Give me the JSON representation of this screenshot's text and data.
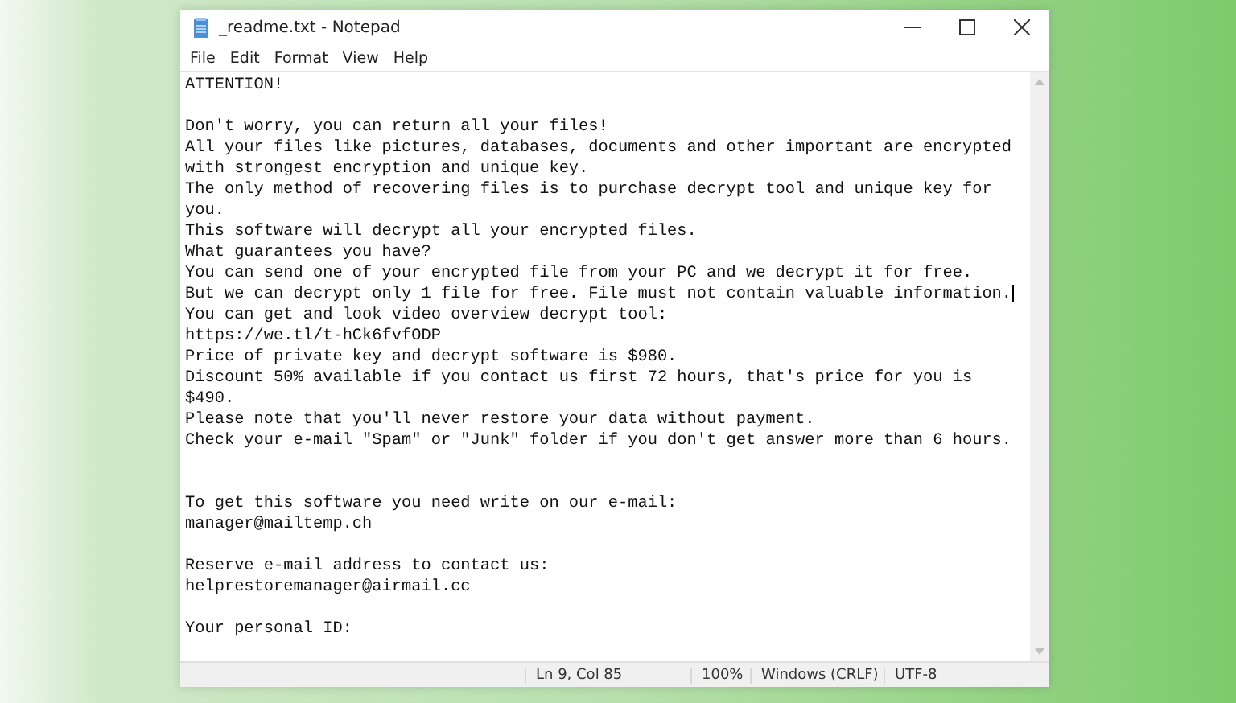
{
  "window": {
    "title": "_readme.txt - Notepad"
  },
  "menu": [
    "File",
    "Edit",
    "Format",
    "View",
    "Help"
  ],
  "lines": [
    {
      "kind": "text",
      "text": "ATTENTION!"
    },
    {
      "kind": "blank"
    },
    {
      "kind": "text",
      "text": "Don't worry, you can return all your files!"
    },
    {
      "kind": "text",
      "text": "All your files like pictures, databases, documents and other important are encrypted"
    },
    {
      "kind": "text",
      "text": "with strongest encryption and unique key."
    },
    {
      "kind": "text",
      "text": "The only method of recovering files is to purchase decrypt tool and unique key for"
    },
    {
      "kind": "text",
      "text": "you."
    },
    {
      "kind": "text",
      "text": "This software will decrypt all your encrypted files."
    },
    {
      "kind": "text",
      "text": "What guarantees you have?"
    },
    {
      "kind": "text",
      "text": "You can send one of your encrypted file from your PC and we decrypt it for free."
    },
    {
      "kind": "text",
      "text": "But we can decrypt only 1 file for free. File must not contain valuable information.",
      "caret": true
    },
    {
      "kind": "text",
      "text": "You can get and look video overview decrypt tool:"
    },
    {
      "kind": "text",
      "text": "https://we.tl/t-hCk6fvfODP"
    },
    {
      "kind": "text",
      "text": "Price of private key and decrypt software is $980."
    },
    {
      "kind": "text",
      "text": "Discount 50% available if you contact us first 72 hours, that's price for you is"
    },
    {
      "kind": "text",
      "text": "$490."
    },
    {
      "kind": "text",
      "text": "Please note that you'll never restore your data without payment."
    },
    {
      "kind": "text",
      "text": "Check your e-mail \"Spam\" or \"Junk\" folder if you don't get answer more than 6 hours."
    },
    {
      "kind": "blank"
    },
    {
      "kind": "blank"
    },
    {
      "kind": "text",
      "text": "To get this software you need write on our e-mail:"
    },
    {
      "kind": "text",
      "text": "manager@mailtemp.ch"
    },
    {
      "kind": "blank"
    },
    {
      "kind": "text",
      "text": "Reserve e-mail address to contact us:"
    },
    {
      "kind": "text",
      "text": "helprestoremanager@airmail.cc"
    },
    {
      "kind": "blank"
    },
    {
      "kind": "text",
      "text": "Your personal ID:"
    }
  ],
  "status_bar": {
    "position": "Ln 9, Col 85",
    "zoom": "100%",
    "line_ending": "Windows (CRLF)",
    "encoding": "UTF-8"
  }
}
